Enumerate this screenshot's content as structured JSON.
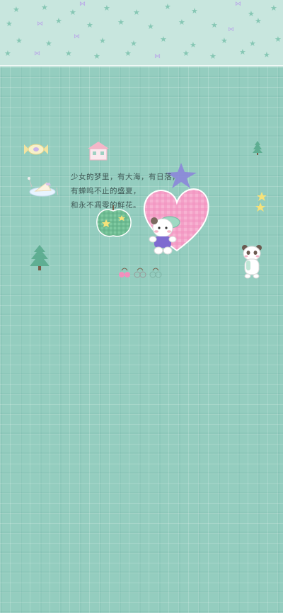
{
  "wallpaper": {
    "background_color": "#94cdbf",
    "band_color": "#c8e6de",
    "quote_lines": [
      "少女的梦里，有大海，有日落，",
      "有蝉鸣不止的盛夏，",
      "和永不凋零的鲜花。"
    ],
    "stickers": [
      "candy-icon",
      "house-icon",
      "cake-icon",
      "star-icon",
      "apple-icon",
      "heart-icon",
      "bear-icon",
      "tree-icon",
      "panda-icon",
      "cherries-icon",
      "mini-tree-icon",
      "small-stars-icon"
    ],
    "accent_colors": {
      "heart": "#f4a3c9",
      "star": "#8b86d9",
      "tree": "#5fae92",
      "apple": "#74c39a"
    }
  }
}
